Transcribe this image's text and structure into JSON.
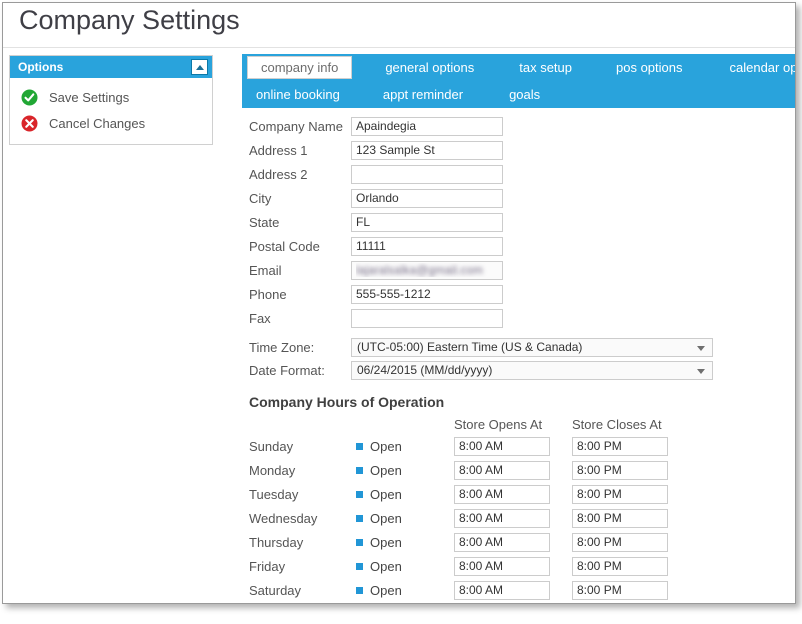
{
  "page": {
    "title": "Company Settings"
  },
  "options_panel": {
    "header": "Options",
    "collapse_icon": "chevron-up-icon",
    "items": [
      {
        "label": "Save Settings",
        "icon": "check-circle-icon",
        "color": "#21a734"
      },
      {
        "label": "Cancel Changes",
        "icon": "x-circle-icon",
        "color": "#d9252a"
      }
    ]
  },
  "tabs": {
    "accent_color": "#29a3dc",
    "row1": [
      {
        "label": "company info",
        "active": true
      },
      {
        "label": "general options",
        "active": false
      },
      {
        "label": "tax setup",
        "active": false
      },
      {
        "label": "pos options",
        "active": false
      },
      {
        "label": "calendar options",
        "active": false
      }
    ],
    "row2": [
      {
        "label": "online booking",
        "active": false
      },
      {
        "label": "appt reminder",
        "active": false
      },
      {
        "label": "goals",
        "active": false
      }
    ]
  },
  "form": {
    "fields": [
      {
        "label": "Company Name",
        "value": "Apaindegia",
        "name": "company-name",
        "blurred": false
      },
      {
        "label": "Address 1",
        "value": "123 Sample St",
        "name": "address-1",
        "blurred": false
      },
      {
        "label": "Address 2",
        "value": "",
        "name": "address-2",
        "blurred": false
      },
      {
        "label": "City",
        "value": "Orlando",
        "name": "city",
        "blurred": false
      },
      {
        "label": "State",
        "value": "FL",
        "name": "state",
        "blurred": false
      },
      {
        "label": "Postal Code",
        "value": "11111",
        "name": "postal-code",
        "blurred": false
      },
      {
        "label": "Email",
        "value": "lajaralsalka@gmail.com",
        "name": "email",
        "blurred": true
      },
      {
        "label": "Phone",
        "value": "555-555-1212",
        "name": "phone",
        "blurred": false
      },
      {
        "label": "Fax",
        "value": "",
        "name": "fax",
        "blurred": false
      }
    ],
    "selects": [
      {
        "label": "Time Zone:",
        "value": "(UTC-05:00) Eastern Time (US & Canada)",
        "name": "time-zone"
      },
      {
        "label": "Date Format:",
        "value": "06/24/2015 (MM/dd/yyyy)",
        "name": "date-format"
      }
    ]
  },
  "hours": {
    "title": "Company Hours of Operation",
    "col_open_header": "Store Opens At",
    "col_close_header": "Store Closes At",
    "open_label": "Open",
    "rows": [
      {
        "day": "Sunday",
        "open": true,
        "opens_at": "8:00 AM",
        "closes_at": "8:00 PM"
      },
      {
        "day": "Monday",
        "open": true,
        "opens_at": "8:00 AM",
        "closes_at": "8:00 PM"
      },
      {
        "day": "Tuesday",
        "open": true,
        "opens_at": "8:00 AM",
        "closes_at": "8:00 PM"
      },
      {
        "day": "Wednesday",
        "open": true,
        "opens_at": "8:00 AM",
        "closes_at": "8:00 PM"
      },
      {
        "day": "Thursday",
        "open": true,
        "opens_at": "8:00 AM",
        "closes_at": "8:00 PM"
      },
      {
        "day": "Friday",
        "open": true,
        "opens_at": "8:00 AM",
        "closes_at": "8:00 PM"
      },
      {
        "day": "Saturday",
        "open": true,
        "opens_at": "8:00 AM",
        "closes_at": "8:00 PM"
      }
    ]
  }
}
